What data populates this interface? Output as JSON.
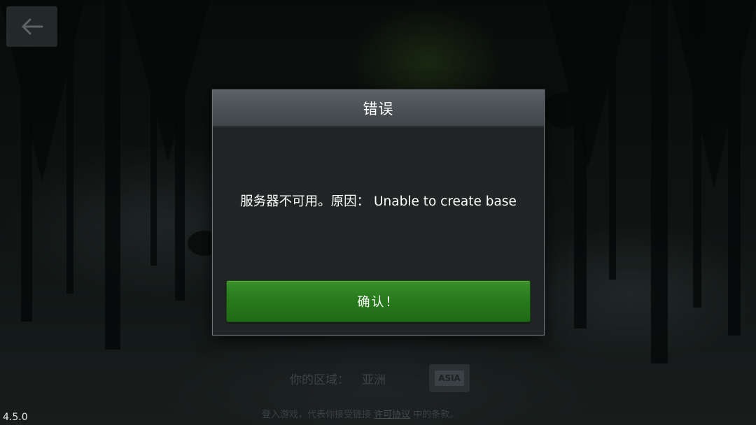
{
  "app": {
    "version": "4.5.0"
  },
  "navigation": {
    "back_icon": "arrow-left-icon"
  },
  "dialog": {
    "title": "错误",
    "message": "服务器不可用。原因： Unable to create base",
    "confirm_label": "确认！"
  },
  "region": {
    "label": "你的区域：",
    "value": "亚洲",
    "badge": "ASIA"
  },
  "license": {
    "prefix": "登入游戏，代表你接受链接",
    "link": "许可协议",
    "suffix": "中的条款。"
  },
  "colors": {
    "confirm_button": "#287a1c",
    "dialog_header": "#4a5053",
    "dialog_body": "#222526"
  }
}
